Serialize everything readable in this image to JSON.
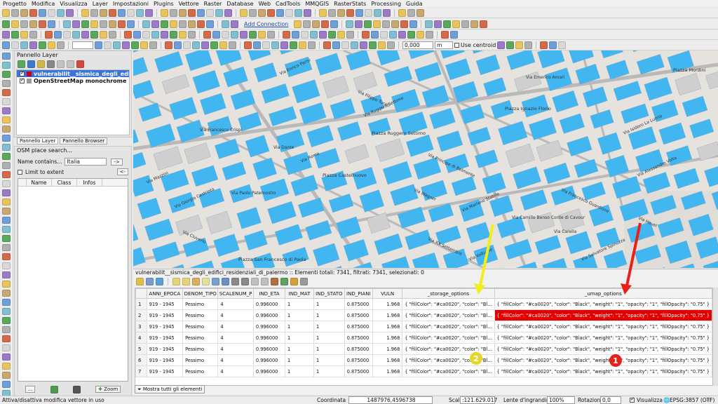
{
  "menubar": {
    "items": [
      "Progetto",
      "Modifica",
      "Visualizza",
      "Layer",
      "Impostazioni",
      "Plugins",
      "Vettore",
      "Raster",
      "Database",
      "Web",
      "CadTools",
      "MMQGIS",
      "RasterStats",
      "Processing",
      "Guida"
    ]
  },
  "toolbar": {
    "add_connection_label": "Add Connection",
    "distance_value": "0,000",
    "unit_value": "m",
    "use_centroid_label": "Use centroid"
  },
  "layers_panel": {
    "title": "Pannello Layer",
    "layers": [
      {
        "name": "vulnerabilit__sismica_degli_edifici_resid...",
        "checked": true,
        "selected": true,
        "swatch": "#ca0020"
      },
      {
        "name": "OpenStreetMap monochrome",
        "checked": true,
        "selected": false,
        "swatch": "#9a9a9a"
      }
    ],
    "tabs": [
      "Pannello Layer",
      "Pannello Browser"
    ]
  },
  "osm_panel": {
    "title": "OSM place search...",
    "name_contains_label": "Name contains...",
    "name_value": "Italia",
    "go_button": "->",
    "limit_extent_label": "Limit to extent",
    "back_button": "<-",
    "columns": [
      "Name",
      "Class",
      "Infos"
    ],
    "footer_buttons": [
      "...",
      "",
      "",
      "Zoom"
    ]
  },
  "map": {
    "street_labels": [
      "Via Ruggero Settimo",
      "Piazza Ruggero Settimo",
      "Via Principe di Belmonte",
      "Via Mariano Stabile",
      "Via Emerico Amari",
      "Piazza Ignazio Florio",
      "Via Roma",
      "Via Dante",
      "Via Filippo Turati",
      "Via Enrico Parisi",
      "Via Francesco Crispi",
      "Piazza Castelnuovo",
      "Via Alessandro Volta",
      "Via Camillo Benso Conte di Cavour",
      "Via Francesco Guardione",
      "Via Isidoro La Lumia",
      "Piazza San Francesco di Paola",
      "Via Cluverio",
      "Via Giorgio Castriota",
      "Via Paolo Paternostro",
      "Via Wagner",
      "Via Mazzini",
      "Via Carella",
      "Via Houel",
      "Via Salvatore Spinuzza",
      "Piazza Mordini",
      "Via XX Settembre",
      "Via Volturno"
    ]
  },
  "attribute_table": {
    "title": "vulnerabilit__sismica_degli_edifici_residenziali_di_palermo :: Elementi totali: 7341, filtrati: 7341, selezionati: 0",
    "columns": [
      "ANNI_EPOCA",
      "DENOM_TIPO",
      "SCALENUM_P",
      "IND_ETA",
      "IND_MAT",
      "IND_STATO",
      "IND_PIANI",
      "VULN",
      "_storage_options",
      "_umap_options"
    ],
    "rows": [
      {
        "n": "1",
        "anni": "919 - 1945",
        "denom": "Pessimo",
        "scale": "4",
        "eta": "0.996000",
        "mat": "1",
        "stato": "1",
        "piani": "0.875000",
        "vuln": "1.968",
        "storage": "{ \"fillColor\": \"#ca0020\", \"color\": \"Bl...",
        "umap": "{ \"fillColor\": \"#ca0020\", \"color\": \"Black\", \"weight\": \"1\", \"opacity\": \"1\", \"fillOpacity\": \"0.75\" }"
      },
      {
        "n": "2",
        "anni": "919 - 1945",
        "denom": "Pessimo",
        "scale": "4",
        "eta": "0.996000",
        "mat": "1",
        "stato": "1",
        "piani": "0.875000",
        "vuln": "1.968",
        "storage": "{ \"fillColor\": \"#ca0020\", \"color\": \"Bl...",
        "umap": "{ \"fillColor\": \"#ca0020\", \"color\": \"Black\", \"weight\": \"1\", \"opacity\": \"1\", \"fillOpacity\": \"0.75\" }"
      },
      {
        "n": "3",
        "anni": "919 - 1945",
        "denom": "Pessimo",
        "scale": "4",
        "eta": "0.996000",
        "mat": "1",
        "stato": "1",
        "piani": "0.875000",
        "vuln": "1.968",
        "storage": "{ \"fillColor\": \"#ca0020\", \"color\": \"Bl...",
        "umap": "{ \"fillColor\": \"#ca0020\", \"color\": \"Black\", \"weight\": \"1\", \"opacity\": \"1\", \"fillOpacity\": \"0.75\" }"
      },
      {
        "n": "4",
        "anni": "919 - 1945",
        "denom": "Pessimo",
        "scale": "4",
        "eta": "0.996000",
        "mat": "1",
        "stato": "1",
        "piani": "0.875000",
        "vuln": "1.968",
        "storage": "{ \"fillColor\": \"#ca0020\", \"color\": \"Bl...",
        "umap": "{ \"fillColor\": \"#ca0020\", \"color\": \"Black\", \"weight\": \"1\", \"opacity\": \"1\", \"fillOpacity\": \"0.75\" }"
      },
      {
        "n": "5",
        "anni": "919 - 1945",
        "denom": "Pessimo",
        "scale": "4",
        "eta": "0.996000",
        "mat": "1",
        "stato": "1",
        "piani": "0.875000",
        "vuln": "1.968",
        "storage": "{ \"fillColor\": \"#ca0020\", \"color\": \"Bl...",
        "umap": "{ \"fillColor\": \"#ca0020\", \"color\": \"Black\", \"weight\": \"1\", \"opacity\": \"1\", \"fillOpacity\": \"0.75\" }"
      },
      {
        "n": "6",
        "anni": "919 - 1945",
        "denom": "Pessimo",
        "scale": "4",
        "eta": "0.996000",
        "mat": "1",
        "stato": "1",
        "piani": "0.875000",
        "vuln": "1.968",
        "storage": "{ \"fillColor\": \"#ca0020\", \"color\": \"Bl...",
        "umap": "{ \"fillColor\": \"#ca0020\", \"color\": \"Black\", \"weight\": \"1\", \"opacity\": \"1\", \"fillOpacity\": \"0.75\" }"
      },
      {
        "n": "7",
        "anni": "919 - 1945",
        "denom": "Pessimo",
        "scale": "4",
        "eta": "0.996000",
        "mat": "1",
        "stato": "1",
        "piani": "0.875000",
        "vuln": "1.968",
        "storage": "{ \"fillColor\": \"#ca0020\", \"color\": \"Bl...",
        "umap": "{ \"fillColor\": \"#ca0020\", \"color\": \"Black\", \"weight\": \"1\", \"opacity\": \"1\", \"fillOpacity\": \"0.75\" }"
      }
    ],
    "show_all_button": "Mostra tutti gli elementi"
  },
  "annotations": {
    "badge_2": "2",
    "badge_1": "1",
    "yellow": "#f2ee1a",
    "red": "#e8201a"
  },
  "statusbar": {
    "message": "Attiva/disattiva modifica vettore in uso",
    "coord_label": "Coordinata",
    "coord_value": "1487976,4596738",
    "scale_label": "Scala",
    "scale_value": ":121.629.017",
    "magnifier_label": "Lente d'ingrandimento",
    "magnifier_value": "100%",
    "rotation_label": "Rotazione",
    "rotation_value": "0,0",
    "render_label": "Visualizza",
    "crs_label": "EPSG:3857 (OTF)"
  },
  "colors": {
    "building": "#41b6f0",
    "selection": "#3a74d4",
    "highlight_row": "#e20000"
  }
}
